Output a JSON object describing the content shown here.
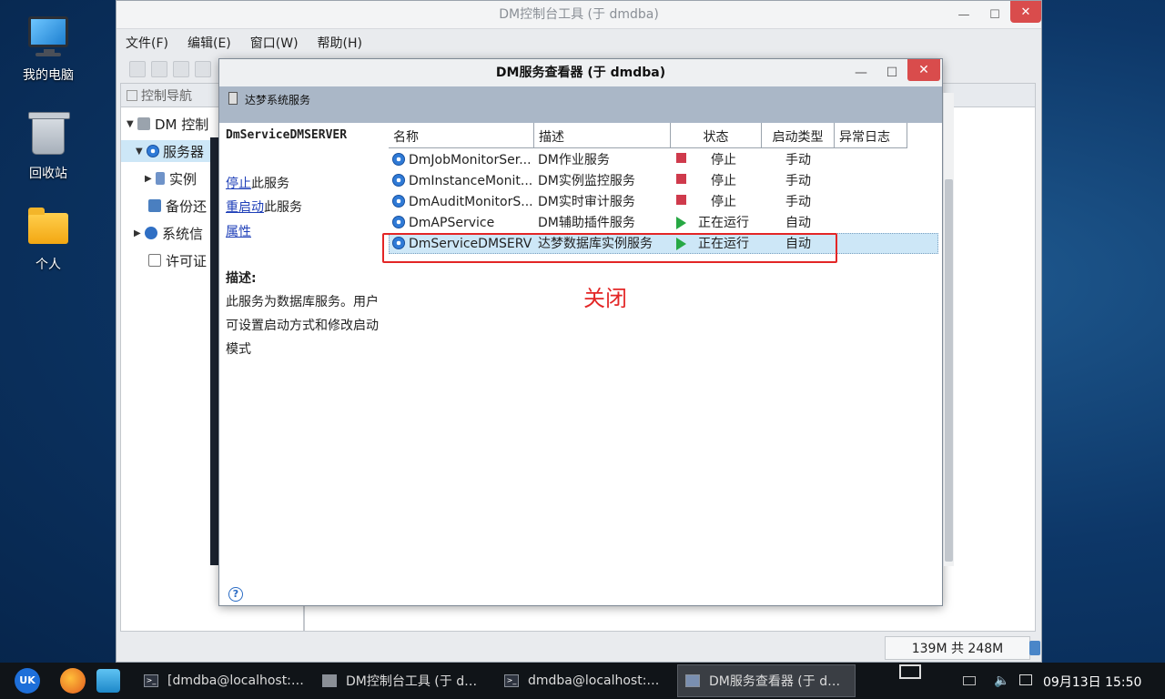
{
  "desktop": {
    "icons": [
      {
        "label": "我的电脑"
      },
      {
        "label": "回收站"
      },
      {
        "label": "个人"
      }
    ]
  },
  "main_window": {
    "title": "DM控制台工具 (于 dmdba)",
    "menu": [
      "文件(F)",
      "编辑(E)",
      "窗口(W)",
      "帮助(H)"
    ],
    "nav_title": "控制导航",
    "tree": [
      {
        "label": "DM 控制"
      },
      {
        "label": "服务器"
      },
      {
        "label": "实例"
      },
      {
        "label": "备份还"
      },
      {
        "label": "系统信"
      },
      {
        "label": "许可证"
      }
    ],
    "memory_status": "139M 共 248M"
  },
  "service_dialog": {
    "title": "DM服务查看器 (于 dmdba)",
    "band_label": "达梦系统服务",
    "selected_service": "DmServiceDMSERVER",
    "actions": {
      "stop_link": "停止",
      "stop_suffix": "此服务",
      "restart_link": "重启动",
      "restart_suffix": "此服务",
      "properties_link": "属性"
    },
    "description_label": "描述:",
    "description_lines": [
      "此服务为数据库服务。用户",
      "可设置启动方式和修改启动",
      "模式"
    ],
    "columns": [
      "名称",
      "描述",
      "状态",
      "启动类型",
      "异常日志"
    ],
    "services": [
      {
        "name": "DmJobMonitorSer...",
        "desc": "DM作业服务",
        "status": "停止",
        "status_icon": "stop",
        "start_type": "手动"
      },
      {
        "name": "DmInstanceMonit...",
        "desc": "DM实例监控服务",
        "status": "停止",
        "status_icon": "stop",
        "start_type": "手动"
      },
      {
        "name": "DmAuditMonitorS...",
        "desc": "DM实时审计服务",
        "status": "停止",
        "status_icon": "stop",
        "start_type": "手动"
      },
      {
        "name": "DmAPService",
        "desc": "DM辅助插件服务",
        "status": "正在运行",
        "status_icon": "running",
        "start_type": "自动"
      },
      {
        "name": "DmServiceDMSERVER",
        "desc": "达梦数据库实例服务",
        "status": "正在运行",
        "status_icon": "running",
        "start_type": "自动"
      }
    ],
    "annotation": "关闭"
  },
  "taskbar": {
    "launcher_label": "UK",
    "tasks": [
      {
        "label": "[dmdba@localhost:…"
      },
      {
        "label": "DM控制台工具 (于 d…"
      },
      {
        "label": "dmdba@localhost:…"
      },
      {
        "label": "DM服务查看器 (于 d…"
      }
    ],
    "clock": "09月13日 15:50"
  },
  "colors": {
    "stop": "#cf3a4c",
    "running": "#27a844",
    "annotation": "#e32626",
    "selection": "#cde7f7"
  }
}
